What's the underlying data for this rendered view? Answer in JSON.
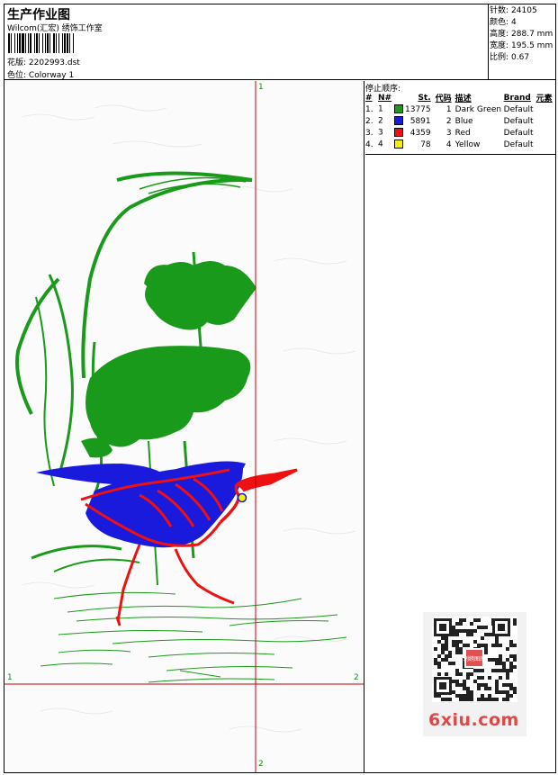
{
  "header": {
    "title": "生产作业图",
    "subtitle": "Wilcom(汇宏) 绣饰工作室",
    "design_label": "花版:",
    "design_file": "2202993.dst",
    "colorway_label": "色位:",
    "colorway": "Colorway 1"
  },
  "stats": [
    {
      "label": "针数:",
      "value": "24105"
    },
    {
      "label": "颜色:",
      "value": "4"
    },
    {
      "label": "高度:",
      "value": "288.7 mm"
    },
    {
      "label": "宽度:",
      "value": "195.5 mm"
    },
    {
      "label": "比例:",
      "value": "0.67"
    }
  ],
  "axis_labels": {
    "top": "1",
    "bottom": "2",
    "left": "1",
    "right": "2"
  },
  "stop_sequence": {
    "title": "停止顺序:",
    "columns": [
      "#",
      "N#",
      "St.",
      "代码",
      "描述",
      "Brand",
      "元素"
    ],
    "rows": [
      {
        "idx": "1.",
        "n": "1",
        "color": "#1a9a1a",
        "st": "13775",
        "code": "1",
        "desc": "Dark Green",
        "brand": "Default",
        "elem": ""
      },
      {
        "idx": "2.",
        "n": "2",
        "color": "#1a1adc",
        "st": "5891",
        "code": "2",
        "desc": "Blue",
        "brand": "Default",
        "elem": ""
      },
      {
        "idx": "3.",
        "n": "3",
        "color": "#ee1111",
        "st": "4359",
        "code": "3",
        "desc": "Red",
        "brand": "Default",
        "elem": ""
      },
      {
        "idx": "4.",
        "n": "4",
        "color": "#f5f000",
        "st": "78",
        "code": "4",
        "desc": "Yellow",
        "brand": "Default",
        "elem": ""
      }
    ]
  },
  "watermark": "6xiu.com",
  "qr_stamp": "刺绣图库",
  "colors": {
    "green": "#1a9a1a",
    "blue": "#1a1adc",
    "red": "#ee1111",
    "yellow": "#f5f000",
    "axis": "#c00000"
  }
}
